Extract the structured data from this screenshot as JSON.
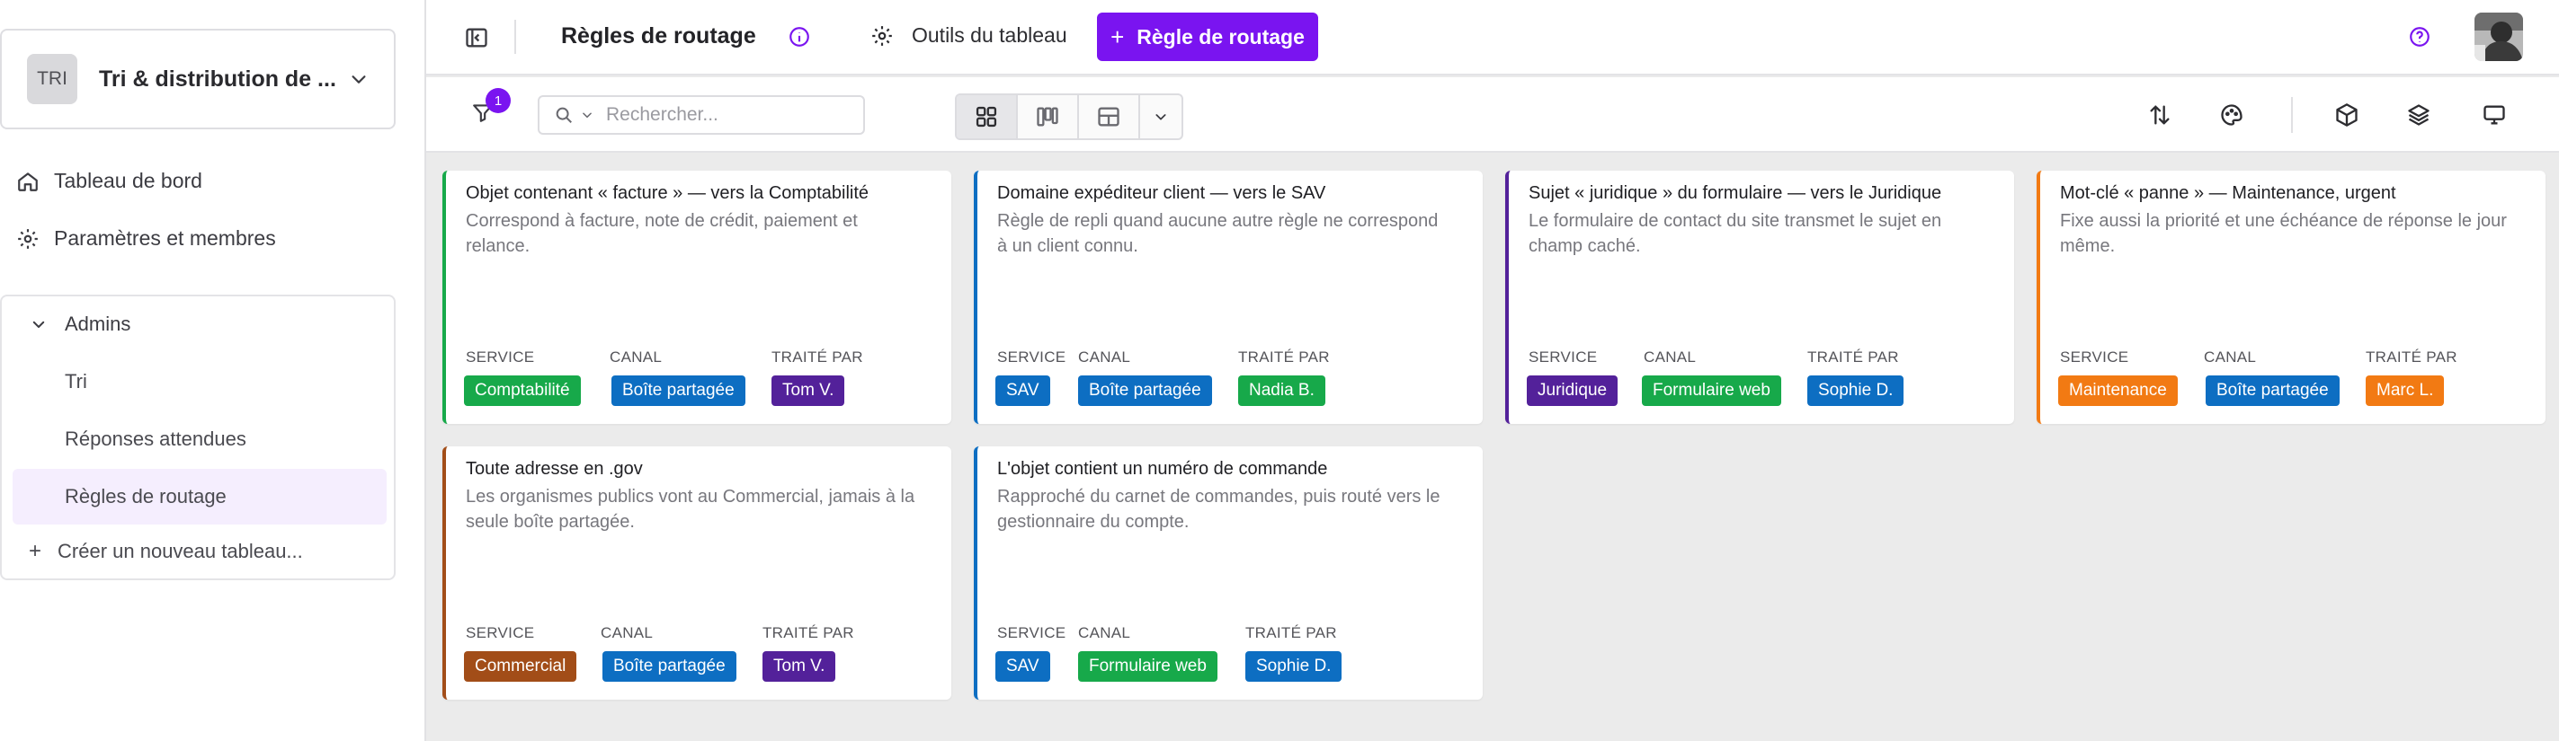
{
  "sidebar": {
    "workspace": {
      "avatar": "TRI",
      "name": "Tri & distribution de ..."
    },
    "nav": [
      {
        "label": "Tableau de bord",
        "icon": "home-icon"
      },
      {
        "label": "Paramètres et membres",
        "icon": "gear-icon"
      }
    ],
    "group": {
      "title": "Admins",
      "items": [
        "Tri",
        "Réponses attendues",
        "Règles de routage"
      ],
      "active": "Règles de routage",
      "create_label": "Créer un nouveau tableau..."
    }
  },
  "topbar": {
    "title": "Règles de routage",
    "tools_label": "Outils du tableau",
    "add_label": "Règle de routage"
  },
  "toolbar": {
    "filter_count": "1",
    "search_placeholder": "Rechercher..."
  },
  "columns": {
    "service": "SERVICE",
    "canal": "CANAL",
    "traite_par": "TRAITÉ PAR"
  },
  "colors": {
    "accent": "#7a14f0",
    "green": "#17a94a",
    "blue": "#0d6ec2",
    "purple": "#53219a",
    "orange": "#f27a13",
    "brown": "#a24d18"
  },
  "cards": [
    {
      "title": "Objet contenant « facture » — vers la Comptabilité",
      "description": "Correspond à facture, note de crédit, paiement et relance.",
      "service": "Comptabilité",
      "canal": "Boîte partagée",
      "traite_par": "Tom V.",
      "border": "#17a94a",
      "service_color": "#17a94a",
      "canal_color": "#0d6ec2",
      "agent_color": "#53219a"
    },
    {
      "title": "Domaine expéditeur client — vers le SAV",
      "description": "Règle de repli quand aucune autre règle ne correspond à un client connu.",
      "service": "SAV",
      "canal": "Boîte partagée",
      "traite_par": "Nadia B.",
      "border": "#0d6ec2",
      "service_color": "#0d6ec2",
      "canal_color": "#0d6ec2",
      "agent_color": "#17a94a"
    },
    {
      "title": "Sujet « juridique » du formulaire — vers le Juridique",
      "description": "Le formulaire de contact du site transmet le sujet en champ caché.",
      "service": "Juridique",
      "canal": "Formulaire web",
      "traite_par": "Sophie D.",
      "border": "#53219a",
      "service_color": "#53219a",
      "canal_color": "#17a94a",
      "agent_color": "#0d6ec2"
    },
    {
      "title": "Mot-clé « panne » — Maintenance, urgent",
      "description": "Fixe aussi la priorité et une échéance de réponse le jour même.",
      "service": "Maintenance",
      "canal": "Boîte partagée",
      "traite_par": "Marc L.",
      "border": "#f27a13",
      "service_color": "#f27a13",
      "canal_color": "#0d6ec2",
      "agent_color": "#f27a13"
    },
    {
      "title": "Toute adresse en .gov",
      "description": "Les organismes publics vont au Commercial, jamais à la seule boîte partagée.",
      "service": "Commercial",
      "canal": "Boîte partagée",
      "traite_par": "Tom V.",
      "border": "#a24d18",
      "service_color": "#a24d18",
      "canal_color": "#0d6ec2",
      "agent_color": "#53219a"
    },
    {
      "title": "L'objet contient un numéro de commande",
      "description": "Rapproché du carnet de commandes, puis routé vers le gestionnaire du compte.",
      "service": "SAV",
      "canal": "Formulaire web",
      "traite_par": "Sophie D.",
      "border": "#0d6ec2",
      "service_color": "#0d6ec2",
      "canal_color": "#17a94a",
      "agent_color": "#0d6ec2"
    }
  ]
}
